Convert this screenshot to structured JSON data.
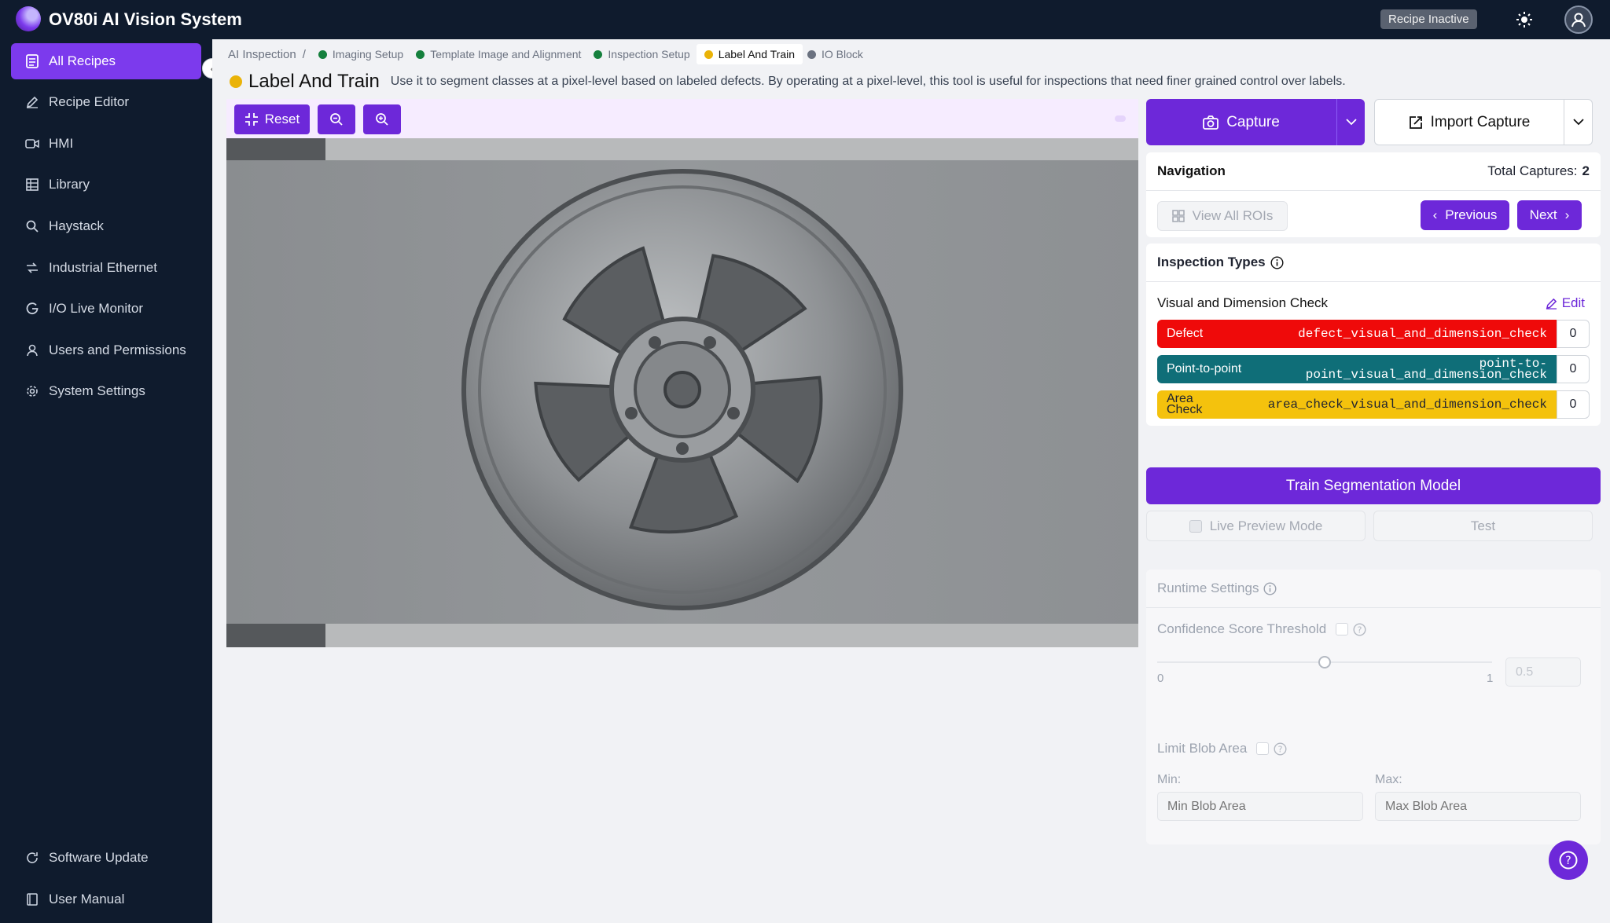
{
  "app": {
    "title": "OV80i AI Vision System",
    "recipe_status": "Recipe Inactive"
  },
  "sidebar": {
    "items": [
      {
        "label": "All Recipes",
        "icon": "document-icon",
        "active": true
      },
      {
        "label": "Recipe Editor",
        "icon": "pencil-icon"
      },
      {
        "label": "HMI",
        "icon": "video-icon"
      },
      {
        "label": "Library",
        "icon": "grid-icon"
      },
      {
        "label": "Haystack",
        "icon": "search-icon"
      },
      {
        "label": "Industrial Ethernet",
        "icon": "network-icon"
      },
      {
        "label": "I/O Live Monitor",
        "icon": "monitor-icon"
      },
      {
        "label": "Users and Permissions",
        "icon": "user-icon"
      },
      {
        "label": "System Settings",
        "icon": "gear-icon"
      }
    ],
    "bottom": [
      {
        "label": "Software Update",
        "icon": "refresh-icon"
      },
      {
        "label": "User Manual",
        "icon": "book-icon"
      }
    ]
  },
  "breadcrumb": {
    "root": "AI Inspection",
    "separator": "/",
    "steps": [
      {
        "label": "Imaging Setup",
        "color": "#15803d"
      },
      {
        "label": "Template Image and Alignment",
        "color": "#15803d"
      },
      {
        "label": "Inspection Setup",
        "color": "#15803d"
      },
      {
        "label": "Label And Train",
        "color": "#eab308"
      },
      {
        "label": "IO Block",
        "color": "#6b7280"
      }
    ]
  },
  "page": {
    "title": "Label And Train",
    "description": "Use it to segment classes at a pixel-level based on labeled defects. By operating at a pixel-level, this tool is useful for inspections that need finer grained control over labels."
  },
  "toolbar": {
    "reset_label": "Reset"
  },
  "capture": {
    "capture_label": "Capture",
    "import_label": "Import Capture"
  },
  "navigation": {
    "title": "Navigation",
    "total_label": "Total Captures:",
    "total_value": "2",
    "view_all_rois": "View All ROIs",
    "previous": "Previous",
    "next": "Next"
  },
  "inspection": {
    "title": "Inspection Types",
    "check_name": "Visual and Dimension Check",
    "edit_label": "Edit",
    "types": [
      {
        "name": "Defect",
        "code": "defect_visual_and_dimension_check",
        "count": "0",
        "bg": "#ef0a0a",
        "fg": "#ffffff"
      },
      {
        "name": "Point-to-point",
        "code": "point-to-point_visual_and_dimension_check",
        "count": "0",
        "bg": "#0f6e78",
        "fg": "#ffffff"
      },
      {
        "name": "Area Check",
        "code": "area_check_visual_and_dimension_check",
        "count": "0",
        "bg": "#f4c20d",
        "fg": "#1f2330"
      }
    ]
  },
  "training": {
    "train_label": "Train Segmentation Model",
    "live_preview": "Live Preview Mode",
    "test_label": "Test"
  },
  "runtime": {
    "title": "Runtime Settings",
    "confidence_label": "Confidence Score Threshold",
    "slider_min": "0",
    "slider_max": "1",
    "slider_value": "0.5",
    "limit_blob_label": "Limit Blob Area",
    "min_label": "Min:",
    "max_label": "Max:",
    "min_placeholder": "Min Blob Area",
    "max_placeholder": "Max Blob Area"
  }
}
